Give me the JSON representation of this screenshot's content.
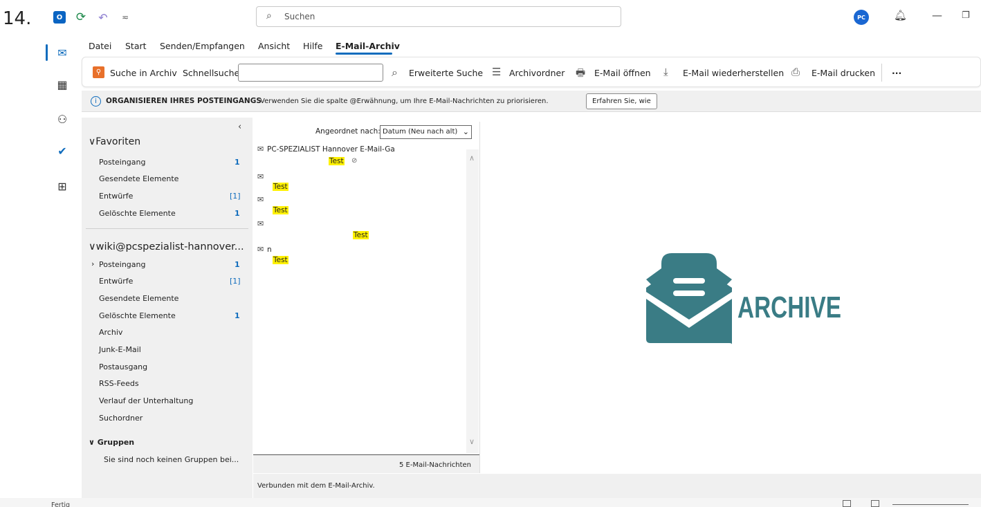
{
  "step_label": "14.",
  "titlebar": {
    "search_placeholder": "Suchen",
    "badge_text": "PC"
  },
  "menu": {
    "tabs": [
      "Datei",
      "Start",
      "Senden/Empfangen",
      "Ansicht",
      "Hilfe",
      "E-Mail-Archiv"
    ],
    "active_tab": "E-Mail-Archiv"
  },
  "ribbon": {
    "archive_search": "Suche in Archiv",
    "quick_search": "Schnellsuche",
    "quick_search_value": "",
    "advanced_search": "Erweiterte Suche",
    "archive_folder": "Archivordner",
    "open_mail": "E-Mail öffnen",
    "restore_mail": "E-Mail wiederherstellen",
    "print_mail": "E-Mail drucken",
    "more": "···"
  },
  "infobar": {
    "title": "ORGANISIEREN IHRES POSTEINGANGS",
    "text": "Verwenden Sie die spalte @Erwähnung, um Ihre E-Mail-Nachrichten zu priorisieren.",
    "button": "Erfahren Sie, wie"
  },
  "folders": {
    "favorites_title": "Favoriten",
    "favorites": [
      {
        "label": "Posteingang",
        "count": "1"
      },
      {
        "label": "Gesendete Elemente",
        "count": ""
      },
      {
        "label": "Entwürfe",
        "count": "[1]"
      },
      {
        "label": "Gelöschte Elemente",
        "count": "1"
      }
    ],
    "account_title": "wiki@pcspezialist-hannover...",
    "account_items": [
      {
        "label": "Posteingang",
        "count": "1"
      },
      {
        "label": "Entwürfe",
        "count": "[1]"
      },
      {
        "label": "Gesendete Elemente",
        "count": ""
      },
      {
        "label": "Gelöschte Elemente",
        "count": "1"
      },
      {
        "label": "Archiv",
        "count": ""
      },
      {
        "label": "Junk-E-Mail",
        "count": ""
      },
      {
        "label": "Postausgang",
        "count": ""
      },
      {
        "label": "RSS-Feeds",
        "count": ""
      },
      {
        "label": "Verlauf der Unterhaltung",
        "count": ""
      },
      {
        "label": "Suchordner",
        "count": ""
      }
    ],
    "groups_title": "Gruppen",
    "groups_note": "Sie sind noch keinen Gruppen bei..."
  },
  "message_list": {
    "sort_label": "Angeordnet nach:",
    "sort_value": "Datum (Neu nach alt)",
    "messages": [
      {
        "from": "PC-SPEZIALIST Hannover E-Mail-Ga",
        "subject": "Test"
      },
      {
        "from": "",
        "subject": "Test"
      },
      {
        "from": "",
        "subject": "Test"
      },
      {
        "from": "",
        "subject": "Test"
      },
      {
        "from": "n",
        "subject": "Test"
      }
    ],
    "count_text": "5 E-Mail-Nachrichten"
  },
  "connection": {
    "text": "Verbunden mit dem E-Mail-Archiv."
  },
  "reading_pane": {
    "logo_text": "ARCHIVE",
    "logo_color": "#3a7c85"
  },
  "status": {
    "text": "Fertig"
  }
}
